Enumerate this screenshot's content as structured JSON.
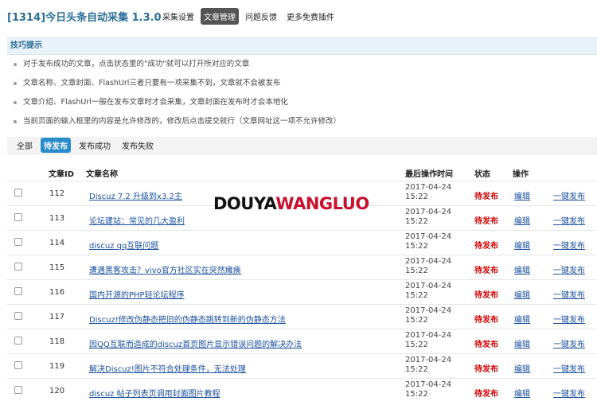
{
  "header": {
    "title": "[1314]今日头条自动采集 1.3.0",
    "nav": [
      {
        "label": "采集设置",
        "active": false
      },
      {
        "label": "文章管理",
        "active": true
      },
      {
        "label": "问题反馈",
        "active": false
      },
      {
        "label": "更多免费插件",
        "active": false
      }
    ]
  },
  "tips": {
    "title": "技巧提示",
    "items": [
      "对于发布成功的文章，点击状态里的\"成功\"就可以打开所对应的文章",
      "文章名称、文章封面、FlashUrl三者只要有一项采集不到，文章就不会被发布",
      "文章介绍、FlashUrl一般在发布文章时才会采集，文章封面在发布时才会本地化",
      "当前页面的输入框里的内容是允许修改的，修改后点击提交就行（文章网址这一项不允许修改）"
    ]
  },
  "filters": [
    {
      "label": "全部",
      "active": false
    },
    {
      "label": "待发布",
      "active": true
    },
    {
      "label": "发布成功",
      "active": false
    },
    {
      "label": "发布失败",
      "active": false
    }
  ],
  "table": {
    "headers": {
      "id": "文章ID",
      "name": "文章名称",
      "time": "最后操作时间",
      "status": "状态",
      "action": "操作"
    },
    "rows": [
      {
        "id": "112",
        "name": "Discuz 7.2 升级到x3.2主",
        "date": "2017-04-24",
        "time": "15:22",
        "status": "待发布",
        "edit": "编辑",
        "publish": "一键发布"
      },
      {
        "id": "113",
        "name": "论坛建站：常见的几大盈利",
        "date": "2017-04-24",
        "time": "15:22",
        "status": "待发布",
        "edit": "编辑",
        "publish": "一键发布"
      },
      {
        "id": "114",
        "name": "discuz qq互联问题",
        "date": "2017-04-24",
        "time": "15:22",
        "status": "待发布",
        "edit": "编辑",
        "publish": "一键发布"
      },
      {
        "id": "115",
        "name": "遭遇黑客攻击？vivo官方社区实在突然瘫痪",
        "date": "2017-04-24",
        "time": "15:22",
        "status": "待发布",
        "edit": "编辑",
        "publish": "一键发布"
      },
      {
        "id": "116",
        "name": "国内开源的PHP轻论坛程序",
        "date": "2017-04-24",
        "time": "15:22",
        "status": "待发布",
        "edit": "编辑",
        "publish": "一键发布"
      },
      {
        "id": "117",
        "name": "Discuz!修改伪静态把旧的伪静态跳转到新的伪静态方法",
        "date": "2017-04-24",
        "time": "15:22",
        "status": "待发布",
        "edit": "编辑",
        "publish": "一键发布"
      },
      {
        "id": "118",
        "name": "因QQ互联而造成的discuz首页图片显示错误问题的解决办法",
        "date": "2017-04-24",
        "time": "15:22",
        "status": "待发布",
        "edit": "编辑",
        "publish": "一键发布"
      },
      {
        "id": "119",
        "name": "解决Discuz!图片不符合处理条件，无法处理",
        "date": "2017-04-24",
        "time": "15:22",
        "status": "待发布",
        "edit": "编辑",
        "publish": "一键发布"
      },
      {
        "id": "120",
        "name": "discuz 帖子列表页调用封面图片教程",
        "date": "2017-04-24",
        "time": "15:22",
        "status": "待发布",
        "edit": "编辑",
        "publish": "一键发布"
      }
    ]
  },
  "watermark": {
    "part1": "DOUYA",
    "part2": "WANGLUO"
  },
  "colors": {
    "accent": "#2a8ccc",
    "title": "#2a6f97",
    "link": "#1a4f9c",
    "status_pending": "#d40000"
  }
}
